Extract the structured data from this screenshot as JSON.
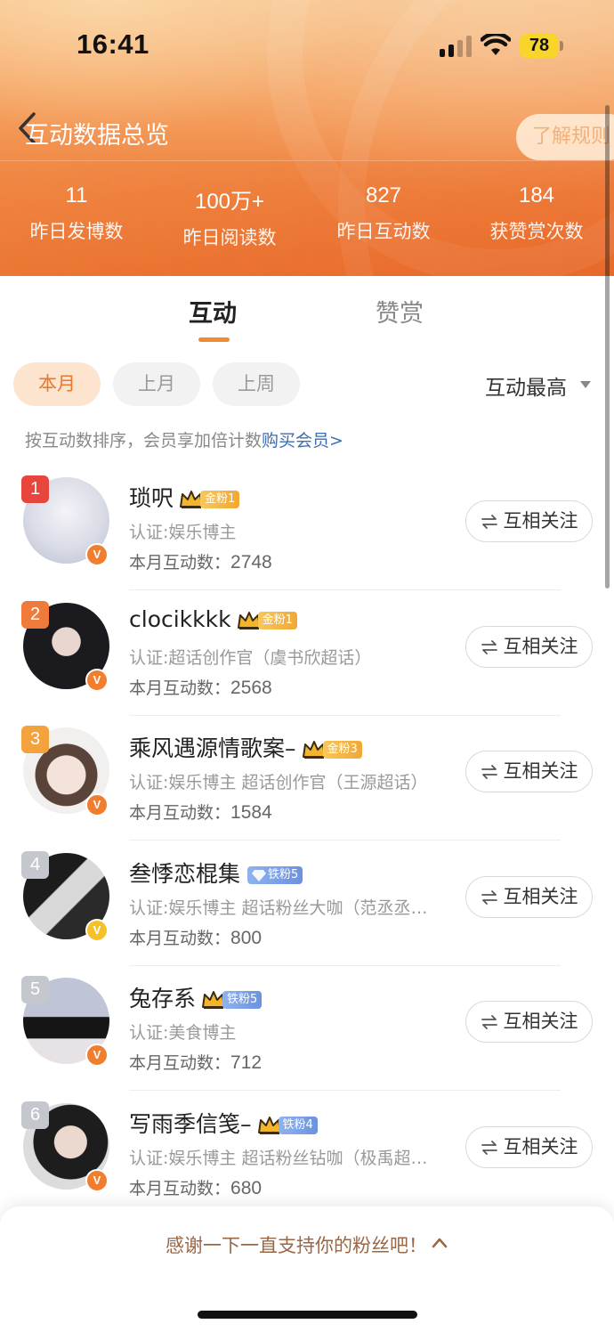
{
  "status_bar": {
    "time": "16:41",
    "battery": "78"
  },
  "header": {
    "title": "互动数据总览",
    "rules_label": "了解规则",
    "stats": [
      {
        "value": "11",
        "label": "昨日发博数"
      },
      {
        "value": "100万+",
        "label": "昨日阅读数"
      },
      {
        "value": "827",
        "label": "昨日互动数"
      },
      {
        "value": "184",
        "label": "获赞赏次数"
      }
    ]
  },
  "tabs": [
    {
      "label": "互动"
    },
    {
      "label": "赞赏"
    }
  ],
  "filters": {
    "chips": [
      "本月",
      "上月",
      "上周"
    ],
    "sort_label": "互动最高"
  },
  "hint": {
    "text": "按互动数排序，会员享加倍计数",
    "link": "购买会员>"
  },
  "list": {
    "follow_label": "互相关注",
    "count_prefix": "本月互动数：",
    "items": [
      {
        "rank": "1",
        "name": "琐呎",
        "fan_tag": "金粉1",
        "fan_type": "gold",
        "cert": "认证:娱乐博主",
        "count": "2748",
        "rank_color": "#e8453c",
        "v_color": "orange"
      },
      {
        "rank": "2",
        "name": "clocikkkk",
        "fan_tag": "金粉1",
        "fan_type": "gold",
        "cert": "认证:超话创作官（虞书欣超话）",
        "count": "2568",
        "rank_color": "#ef7a39",
        "v_color": "orange"
      },
      {
        "rank": "3",
        "name": "乘风遇源情歌案–",
        "fan_tag": "金粉3",
        "fan_type": "gold",
        "cert": "认证:娱乐博主 超话创作官（王源超话）",
        "count": "1584",
        "rank_color": "#f3a23d",
        "v_color": "orange"
      },
      {
        "rank": "4",
        "name": "叁悸恋棍集",
        "fan_tag": "铁粉5",
        "fan_type": "iron-diamond",
        "cert": "认证:娱乐博主 超话粉丝大咖（范丞丞超话）",
        "count": "800",
        "rank_color": "#c4c7ce",
        "v_color": "gold"
      },
      {
        "rank": "5",
        "name": "兔存系",
        "fan_tag": "铁粉5",
        "fan_type": "iron",
        "cert": "认证:美食博主",
        "count": "712",
        "rank_color": "#c4c7ce",
        "v_color": "orange"
      },
      {
        "rank": "6",
        "name": "写雨季信笺–",
        "fan_tag": "铁粉4",
        "fan_type": "iron",
        "cert": "认证:娱乐博主 超话粉丝钻咖（极禹超话）",
        "count": "680",
        "rank_color": "#c4c7ce",
        "v_color": "orange"
      }
    ]
  },
  "bottom": {
    "thanks": "感谢一下一直支持你的粉丝吧！"
  }
}
